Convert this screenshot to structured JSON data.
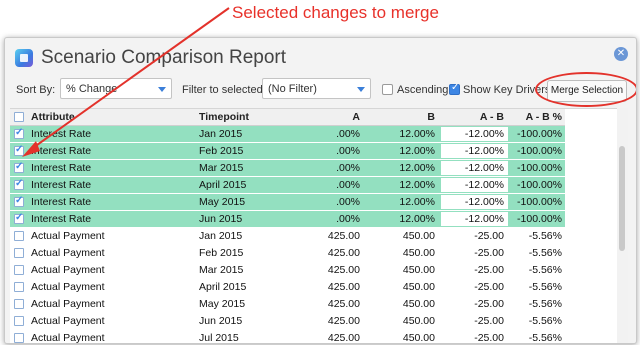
{
  "annotation": {
    "text": "Selected changes to merge"
  },
  "window": {
    "title": "Scenario Comparison Report"
  },
  "toolbar": {
    "sort_label": "Sort By:",
    "sort_value": "% Change",
    "filter_label": "Filter to selected:",
    "filter_value": "(No Filter)",
    "ascending_label": "Ascending",
    "ascending_checked": false,
    "key_drivers_label": "Show Key Drivers",
    "key_drivers_checked": true,
    "merge_label": "Merge Selection"
  },
  "table": {
    "headers": {
      "attribute": "Attribute",
      "timepoint": "Timepoint",
      "a": "A",
      "b": "B",
      "a_b": "A - B",
      "a_b_pct": "A - B %"
    },
    "rows": [
      {
        "selected": true,
        "attribute": "Interest Rate",
        "timepoint": "Jan 2015",
        "a": ".00%",
        "b": "12.00%",
        "a_b": "-12.00%",
        "a_b_pct": "-100.00%"
      },
      {
        "selected": true,
        "attribute": "Interest Rate",
        "timepoint": "Feb 2015",
        "a": ".00%",
        "b": "12.00%",
        "a_b": "-12.00%",
        "a_b_pct": "-100.00%"
      },
      {
        "selected": true,
        "attribute": "Interest Rate",
        "timepoint": "Mar 2015",
        "a": ".00%",
        "b": "12.00%",
        "a_b": "-12.00%",
        "a_b_pct": "-100.00%"
      },
      {
        "selected": true,
        "attribute": "Interest Rate",
        "timepoint": "April 2015",
        "a": ".00%",
        "b": "12.00%",
        "a_b": "-12.00%",
        "a_b_pct": "-100.00%"
      },
      {
        "selected": true,
        "attribute": "Interest Rate",
        "timepoint": "May 2015",
        "a": ".00%",
        "b": "12.00%",
        "a_b": "-12.00%",
        "a_b_pct": "-100.00%"
      },
      {
        "selected": true,
        "attribute": "Interest Rate",
        "timepoint": "Jun 2015",
        "a": ".00%",
        "b": "12.00%",
        "a_b": "-12.00%",
        "a_b_pct": "-100.00%"
      },
      {
        "selected": false,
        "attribute": "Actual Payment",
        "timepoint": "Jan 2015",
        "a": "425.00",
        "b": "450.00",
        "a_b": "-25.00",
        "a_b_pct": "-5.56%"
      },
      {
        "selected": false,
        "attribute": "Actual Payment",
        "timepoint": "Feb 2015",
        "a": "425.00",
        "b": "450.00",
        "a_b": "-25.00",
        "a_b_pct": "-5.56%"
      },
      {
        "selected": false,
        "attribute": "Actual Payment",
        "timepoint": "Mar 2015",
        "a": "425.00",
        "b": "450.00",
        "a_b": "-25.00",
        "a_b_pct": "-5.56%"
      },
      {
        "selected": false,
        "attribute": "Actual Payment",
        "timepoint": "April 2015",
        "a": "425.00",
        "b": "450.00",
        "a_b": "-25.00",
        "a_b_pct": "-5.56%"
      },
      {
        "selected": false,
        "attribute": "Actual Payment",
        "timepoint": "May 2015",
        "a": "425.00",
        "b": "450.00",
        "a_b": "-25.00",
        "a_b_pct": "-5.56%"
      },
      {
        "selected": false,
        "attribute": "Actual Payment",
        "timepoint": "Jun 2015",
        "a": "425.00",
        "b": "450.00",
        "a_b": "-25.00",
        "a_b_pct": "-5.56%"
      },
      {
        "selected": false,
        "attribute": "Actual Payment",
        "timepoint": "Jul 2015",
        "a": "425.00",
        "b": "450.00",
        "a_b": "-25.00",
        "a_b_pct": "-5.56%"
      }
    ]
  },
  "colors": {
    "selected_row": "#93e0c0",
    "annotation": "#e3322b",
    "accent": "#3d86e4"
  }
}
